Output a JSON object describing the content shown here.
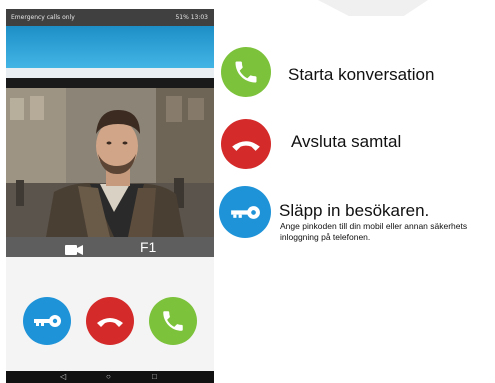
{
  "phone": {
    "status_left": "Emergency calls only",
    "status_right": "51% 13:03",
    "channel_label": "F1",
    "icons": [
      "camera-icon",
      "key-icon",
      "hangup-icon",
      "phone-icon",
      "back-icon",
      "home-icon",
      "recent-apps-icon"
    ],
    "nav": {
      "back": "◁",
      "home": "○",
      "recent": "□"
    },
    "colors": {
      "header": "#2b9fd6",
      "key_button": "#1f93d8",
      "hangup_button": "#d42a2a",
      "answer_button": "#7cc23b"
    }
  },
  "legend": {
    "answer_label": "Starta konversation",
    "hangup_label": "Avsluta samtal",
    "unlock_label": "Släpp in besökaren.",
    "unlock_description": "Ange pinkoden till din mobil eller annan säkerhets inloggning på telefonen."
  }
}
